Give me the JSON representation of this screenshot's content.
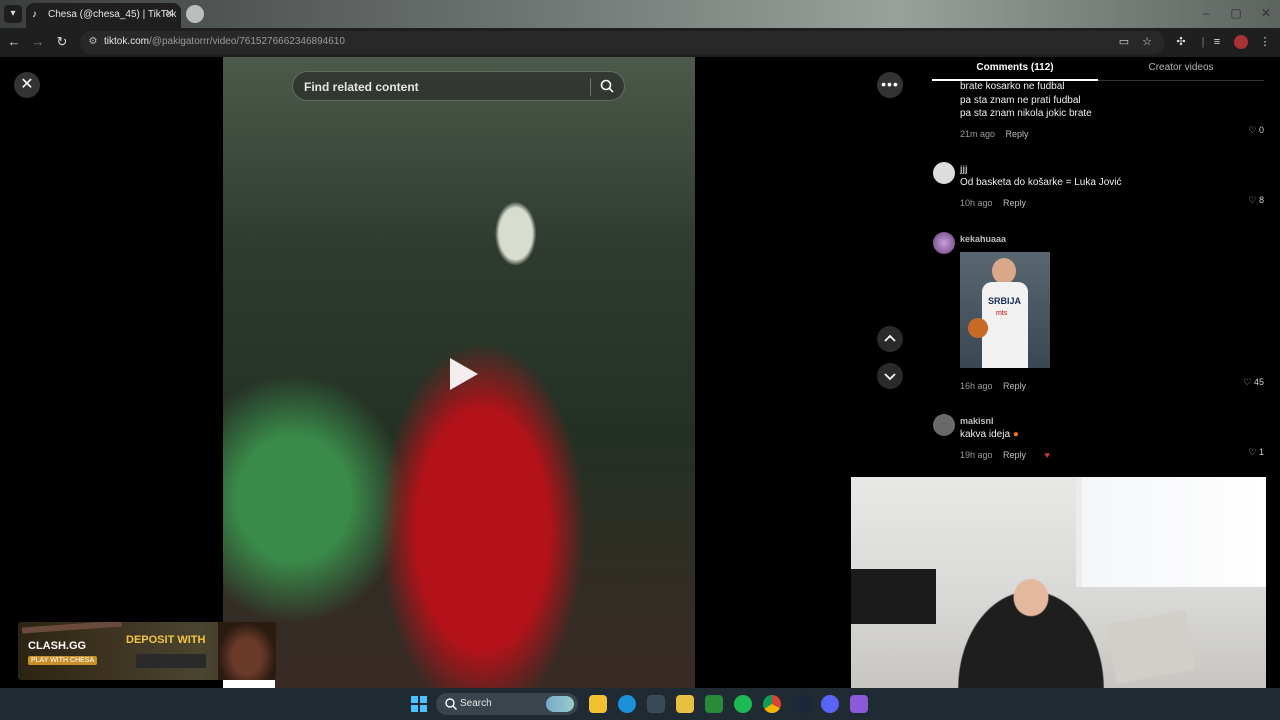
{
  "browser": {
    "tab": {
      "title": "Chesa (@chesa_45) | TikTok",
      "favicon": "tiktok-icon"
    },
    "url": {
      "host": "tiktok.com",
      "path": "/@pakigatorrr/video/7615276662346894610"
    },
    "icons": [
      "back-icon",
      "forward-icon",
      "reload-icon",
      "site-info-icon",
      "cast-icon",
      "star-icon",
      "extensions-icon",
      "tab-search-icon",
      "profile-icon",
      "menu-icon"
    ]
  },
  "video": {
    "search": {
      "placeholder": "Find related content"
    },
    "more_label": "•••"
  },
  "comments_panel": {
    "tabs": {
      "comments": "Comments (112)",
      "creator": "Creator videos"
    },
    "comments": [
      {
        "lines": [
          "brate kosarko ne fudbal",
          "pa sta znam ne prati fudbal",
          "pa sta znam nikola jokic brate"
        ],
        "time": "21m ago",
        "reply": "Reply",
        "likes": "0"
      },
      {
        "user": "jjj",
        "lines": [
          "Od basketa do košarke = Luka Jović"
        ],
        "time": "10h ago",
        "reply": "Reply",
        "likes": "8"
      },
      {
        "user": "kekahuaaa",
        "image_text": {
          "brand": "SRBIJA",
          "sponsor": "mts"
        },
        "time": "16h ago",
        "reply": "Reply",
        "likes": "45"
      },
      {
        "user": "makisnl",
        "lines": [
          "kakva ideja"
        ],
        "time": "19h ago",
        "reply": "Reply",
        "likes": "1"
      }
    ]
  },
  "promo": {
    "brand": "CLASH.GG",
    "sub": "PLAY WITH CHESA",
    "cta": "DEPOSIT WITH"
  },
  "taskbar": {
    "search_label": "Search"
  },
  "colors": {
    "background": "#000000",
    "chrome": "#1f1f1f",
    "accent_red": "#b31219"
  }
}
